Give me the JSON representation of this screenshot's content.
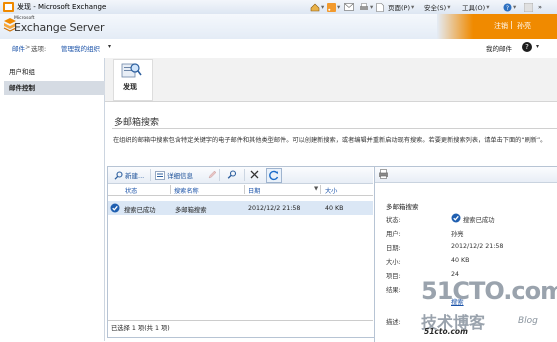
{
  "browser": {
    "title": "发现 - Microsoft Exchange",
    "toolbar": [
      "页面(P)",
      "安全(S)",
      "工具(O)"
    ]
  },
  "header": {
    "logo_small": "Microsoft",
    "logo": "Exchange Server",
    "signout": "注销",
    "user": "孙亮"
  },
  "nav": {
    "mail": "邮件",
    "sep": ">",
    "options": "选项:",
    "org": "管理我的组织",
    "my_mail": "我的邮件",
    "help": "?"
  },
  "sidebar": {
    "items": [
      {
        "label": "用户和组"
      },
      {
        "label": "邮件控制"
      }
    ]
  },
  "tools": {
    "find_label": "发现"
  },
  "main": {
    "title": "多邮箱搜索",
    "description": "在组织的邮箱中搜索包含特定关键字的电子邮件和其他类型邮件。可以创建新搜索，或者编辑并重新启动现有搜索。若要更新搜索列表，请单击下面的“刷新”。"
  },
  "list": {
    "toolbar": {
      "new": "新建...",
      "details": "详细信息"
    },
    "columns": [
      "状态",
      "搜索名称",
      "日期",
      "大小"
    ],
    "rows": [
      {
        "status": "搜索已成功",
        "name": "多邮箱搜索",
        "date": "2012/12/2 21:58",
        "size": "40 KB"
      }
    ],
    "status_text": "已选择 1 项(共 1 项)"
  },
  "detail": {
    "title": "多邮箱搜索",
    "fields": [
      {
        "key": "状态:",
        "value": "搜索已成功"
      },
      {
        "key": "用户:",
        "value": "孙亮"
      },
      {
        "key": "日期:",
        "value": "2012/12/2 21:58"
      },
      {
        "key": "大小:",
        "value": "40 KB"
      },
      {
        "key": "项目:",
        "value": "24"
      },
      {
        "key": "结果:",
        "value": ""
      },
      {
        "key": "描述:",
        "value": ""
      }
    ],
    "link": "搜索"
  },
  "watermark": {
    "main": "51CTO.com",
    "sub": "技术博客",
    "blog": "Blog",
    "site": "51cto.com"
  },
  "colors": {
    "accent": "#f08a00",
    "link": "#1a52a8",
    "selected_row": "#dbe7f5"
  }
}
